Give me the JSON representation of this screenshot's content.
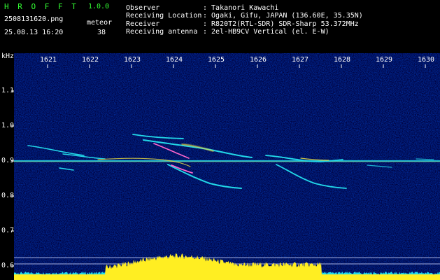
{
  "header": {
    "app_name": "H R O F F T",
    "version": "1.0.0",
    "filename": "2508131620.png",
    "datetime": "25.08.13 16:20",
    "meteor_label": "meteor",
    "meteor_count": "38",
    "info_rows": [
      {
        "key": "Observer",
        "value": ": Takanori Kawachi"
      },
      {
        "key": "Receiving Location",
        "value": ": Ogaki, Gifu, JAPAN (136.60E, 35.35N)"
      },
      {
        "key": "Receiver",
        "value": ": R820T2(RTL-SDR) SDR-Sharp 53.372MHz"
      },
      {
        "key": "Receiving antenna",
        "value": ": 2el-HB9CV Vertical (el. E-W)"
      }
    ]
  },
  "axis": {
    "unit": "kHz",
    "y_ticks": [
      "1.1",
      "1.0",
      "0.9",
      "0.8",
      "0.7",
      "0.6"
    ],
    "x_ticks": [
      "1621",
      "1622",
      "1623",
      "1624",
      "1625",
      "1626",
      "1627",
      "1628",
      "1629",
      "1630"
    ]
  },
  "colors": {
    "background_noise": "#00003a",
    "trace_cyan": "#22d8e8",
    "trace_yellow": "#f0e040",
    "spectrum_yellow": "#ffee22",
    "spectrum_cyan": "#22ddee",
    "header_green": "#33ff33"
  }
}
